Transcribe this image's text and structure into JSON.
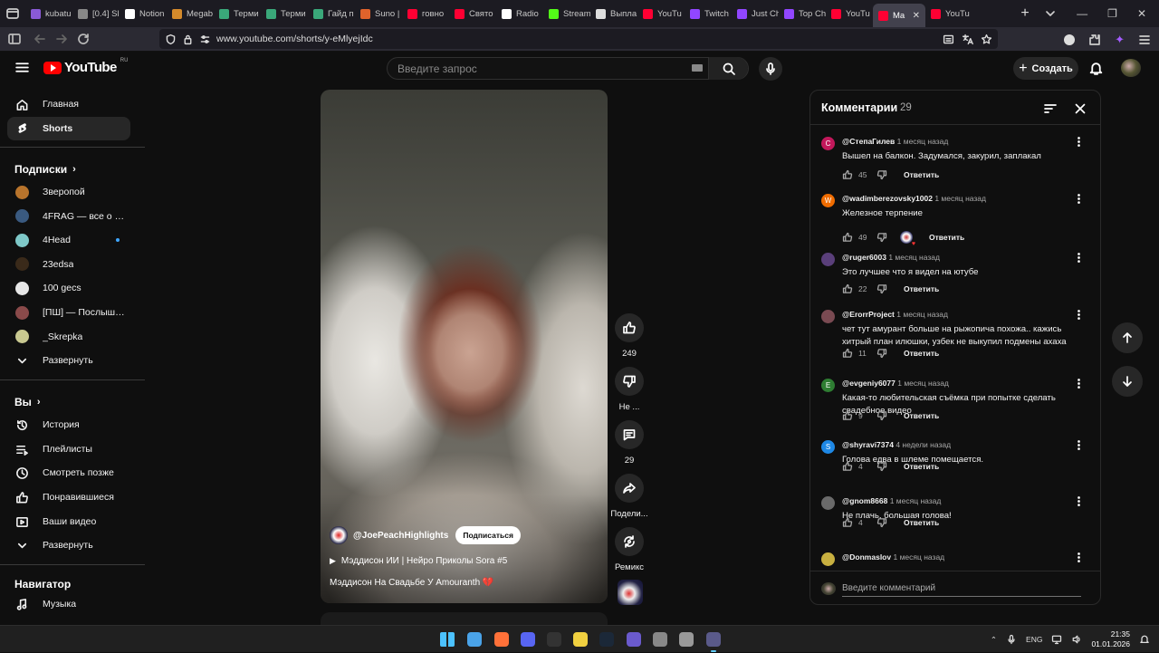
{
  "browser": {
    "tabs": [
      {
        "label": "kubatu",
        "color": "#8a5ad6"
      },
      {
        "label": "[0.4] Sl",
        "color": "#888888"
      },
      {
        "label": "Notion",
        "color": "#ffffff"
      },
      {
        "label": "Megab",
        "color": "#d48a2b"
      },
      {
        "label": "Терми",
        "color": "#3aa87a"
      },
      {
        "label": "Терми",
        "color": "#3aa87a"
      },
      {
        "label": "Гайд п",
        "color": "#3aa87a"
      },
      {
        "label": "Suno |",
        "color": "#e0632b"
      },
      {
        "label": "говно",
        "color": "#ff0033"
      },
      {
        "label": "Свято",
        "color": "#ff0033"
      },
      {
        "label": "Radio",
        "color": "#ffffff"
      },
      {
        "label": "Stream",
        "color": "#53fc18"
      },
      {
        "label": "Выпла",
        "color": "#dddddd"
      },
      {
        "label": "YouTu",
        "color": "#ff0033"
      },
      {
        "label": "Twitch",
        "color": "#9146ff"
      },
      {
        "label": "Just Ch",
        "color": "#9146ff"
      },
      {
        "label": "Top Ch",
        "color": "#9146ff"
      },
      {
        "label": "YouTu",
        "color": "#ff0033"
      },
      {
        "label": "Ma",
        "color": "#ff0033",
        "active": true
      },
      {
        "label": "YouTu",
        "color": "#ff0033"
      }
    ],
    "url": "www.youtube.com/shorts/y-eMlyejIdc"
  },
  "header": {
    "logo_text": "YouTube",
    "region": "RU",
    "search_placeholder": "Введите запрос",
    "create_label": "Создать"
  },
  "sidebar": {
    "main": [
      {
        "label": "Главная",
        "icon": "home-icon"
      },
      {
        "label": "Shorts",
        "icon": "shorts-icon",
        "selected": true
      }
    ],
    "subscriptions_title": "Подписки",
    "channels": [
      {
        "label": "Зверопой",
        "color": "#b8742c"
      },
      {
        "label": "4FRAG — все о сов...",
        "color": "#3a5a80"
      },
      {
        "label": "4Head",
        "color": "#7ec8c8",
        "live": true
      },
      {
        "label": "23edsa",
        "color": "#3a2a1a"
      },
      {
        "label": "100 gecs",
        "color": "#e6e6e6"
      },
      {
        "label": "[ПШ] — Послышал...",
        "color": "#8a4a4a"
      },
      {
        "label": "_Skrepka",
        "color": "#c8c890"
      }
    ],
    "expand_label": "Развернуть",
    "you_title": "Вы",
    "you_items": [
      {
        "label": "История",
        "icon": "history-icon"
      },
      {
        "label": "Плейлисты",
        "icon": "playlists-icon"
      },
      {
        "label": "Смотреть позже",
        "icon": "watch-later-icon"
      },
      {
        "label": "Понравившиеся",
        "icon": "liked-icon"
      },
      {
        "label": "Ваши видео",
        "icon": "your-videos-icon"
      },
      {
        "label": "Развернуть",
        "icon": "chevron-down-icon"
      }
    ],
    "navigator_title": "Навигатор",
    "navigator_items": [
      {
        "label": "Музыка",
        "icon": "music-icon"
      }
    ]
  },
  "short": {
    "channel": "@JoePeachHighlights",
    "subscribe_label": "Подписаться",
    "playlist": "Мэддисон ИИ | Нейро Приколы Sora #5",
    "title": "Мэддисон На Свадьбе У Amouranth 💔",
    "likes": "249",
    "dislike_label": "Не ...",
    "comments": "29",
    "share_label": "Подели...",
    "remix_label": "Ремикс"
  },
  "comments": {
    "title": "Комментарии",
    "count": "29",
    "input_placeholder": "Введите комментарий",
    "reply_label": "Ответить",
    "items": [
      {
        "author": "@СтепаГилев",
        "time": "1 месяц назад",
        "text": "Вышел на балкон. Задумался, закурил, заплакал",
        "likes": "45",
        "avatar_letter": "С",
        "avatar_color": "#c2185b"
      },
      {
        "author": "@wadimberezovsky1002",
        "time": "1 месяц назад",
        "text": "Железное терпение",
        "likes": "49",
        "avatar_letter": "W",
        "avatar_color": "#ef6c00",
        "hearted": true
      },
      {
        "author": "@ruger6003",
        "time": "1 месяц назад",
        "text": "Это лучшее что я видел на ютубе",
        "likes": "22",
        "avatar_letter": "",
        "avatar_color": "#5a3f7a"
      },
      {
        "author": "@ErorrProject",
        "time": "1 месяц назад",
        "text": "чет тут амурант больше на рыжопича похожа.. кажись хитрый план илюшки, узбек не выкупил подмены ахаха",
        "likes": "11",
        "avatar_letter": "",
        "avatar_color": "#7a4a52"
      },
      {
        "author": "@evgeniy6077",
        "time": "1 месяц назад",
        "text": "Какая-то любительская съёмка при попытке сделать свадебное видео",
        "likes": "9",
        "avatar_letter": "E",
        "avatar_color": "#2e7d32"
      },
      {
        "author": "@shyravi7374",
        "time": "4 недели назад",
        "text": "Голова едва в шлеме помещается.",
        "likes": "4",
        "avatar_letter": "S",
        "avatar_color": "#1e88e5"
      },
      {
        "author": "@gnom8668",
        "time": "1 месяц назад",
        "text": "Не плачь, большая голова!",
        "likes": "4",
        "avatar_letter": "",
        "avatar_color": "#6a6a6a"
      },
      {
        "author": "@Donmaslov",
        "time": "1 месяц назад",
        "text": "",
        "likes": "",
        "avatar_letter": "",
        "avatar_color": "#c8b040"
      }
    ]
  },
  "taskbar": {
    "lang": "ENG",
    "time": "21:35",
    "date": "01.01.2026",
    "apps": [
      {
        "name": "start-button",
        "color": "#4cc2ff"
      },
      {
        "name": "file-explorer",
        "color": "#4aa3e8"
      },
      {
        "name": "firefox",
        "color": "#ff7139"
      },
      {
        "name": "discord",
        "color": "#5865f2"
      },
      {
        "name": "terminal",
        "color": "#333333"
      },
      {
        "name": "app-yellow",
        "color": "#f0d040"
      },
      {
        "name": "steam",
        "color": "#1b2838"
      },
      {
        "name": "app-triangle",
        "color": "#6a5acd"
      },
      {
        "name": "app-circle",
        "color": "#888888"
      },
      {
        "name": "settings",
        "color": "#999999"
      },
      {
        "name": "browser-active",
        "color": "#5a5a8a",
        "active": true
      }
    ]
  }
}
